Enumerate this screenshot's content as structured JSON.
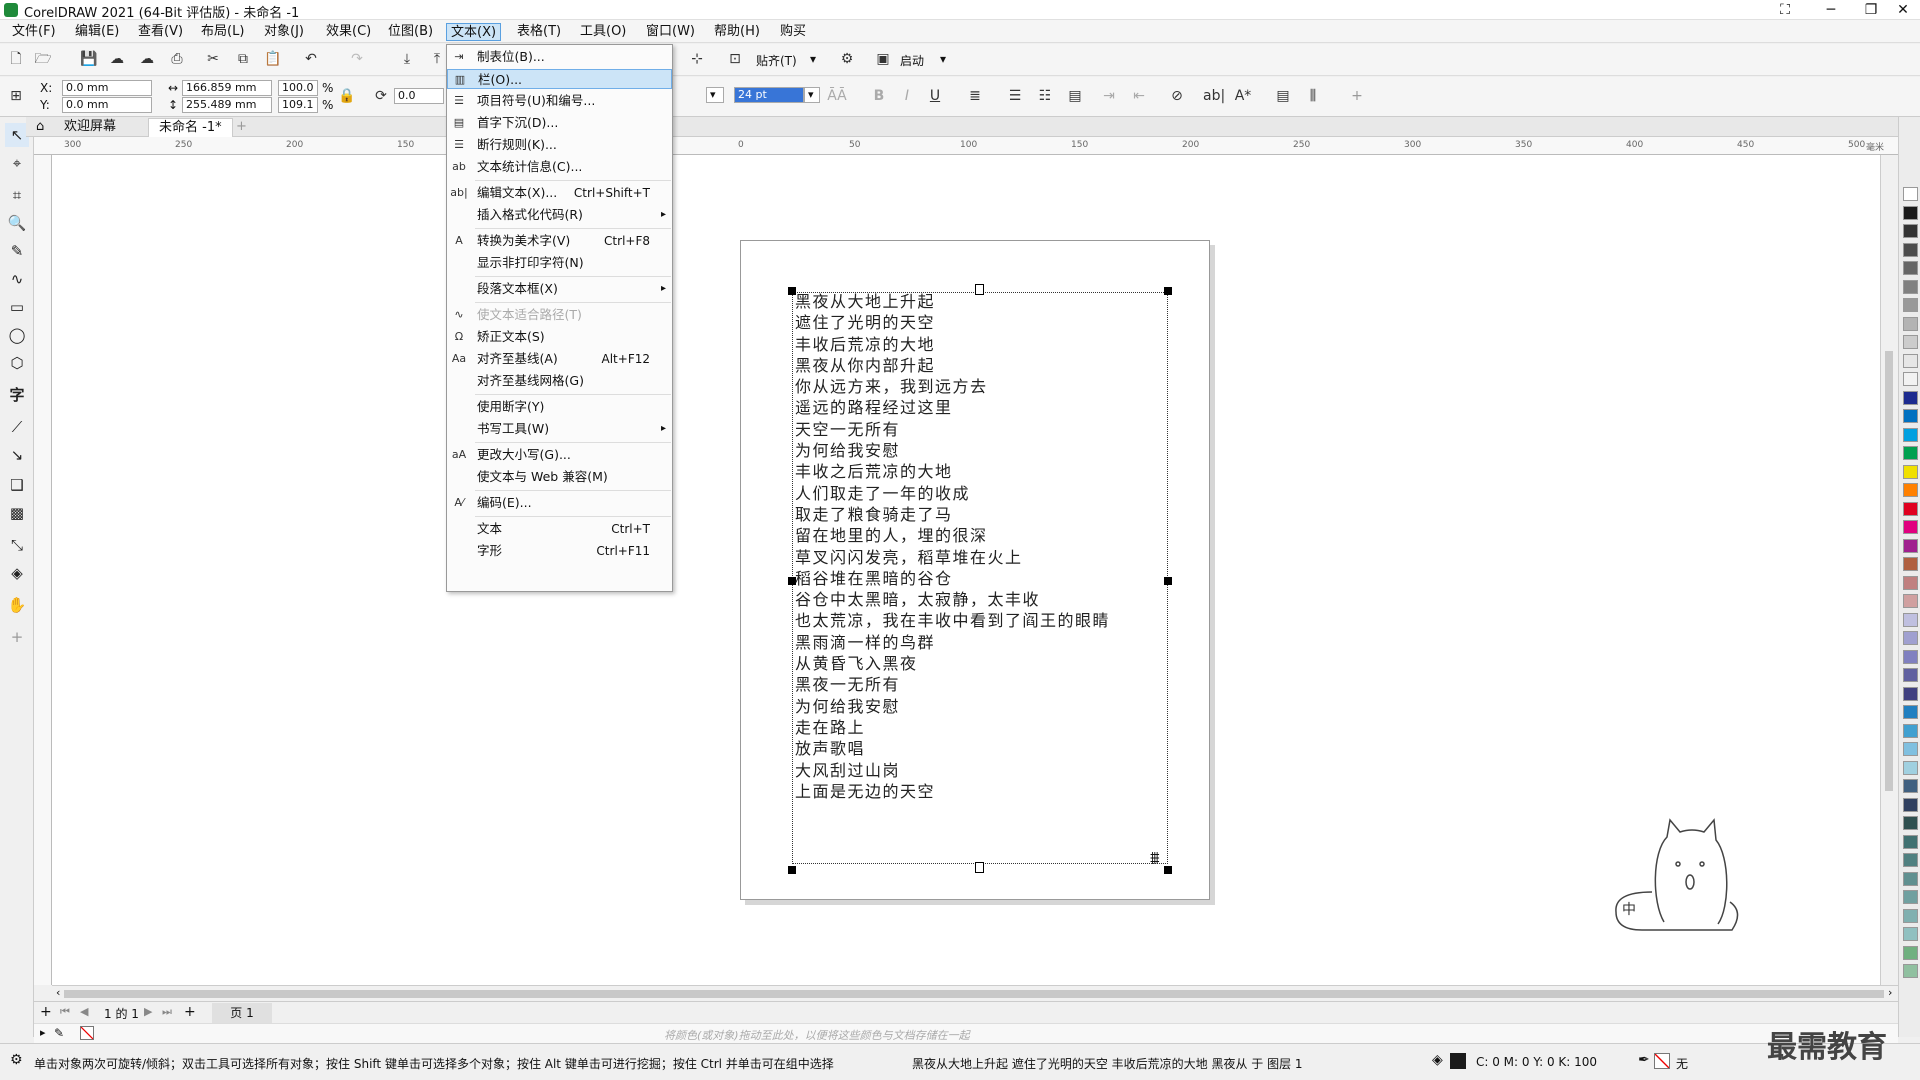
{
  "app": {
    "title": "CorelDRAW 2021 (64-Bit 评估版) - 未命名 -1"
  },
  "menu": [
    "文件(F)",
    "编辑(E)",
    "查看(V)",
    "布局(L)",
    "对象(J)",
    "效果(C)",
    "位图(B)",
    "文本(X)",
    "表格(T)",
    "工具(O)",
    "窗口(W)",
    "帮助(H)",
    "购买"
  ],
  "toolbar": {
    "snap_label": "贴齐(T)",
    "launch_label": "启动"
  },
  "props": {
    "x": "0.0 mm",
    "y": "0.0 mm",
    "w": "166.859 mm",
    "h": "255.489 mm",
    "sx": "100.0",
    "sy": "109.1",
    "pct": "%",
    "angle": "0.0",
    "font_size": "24 pt"
  },
  "tabs": {
    "welcome": "欢迎屏幕",
    "doc": "未命名 -1*"
  },
  "ruler": {
    "h": [
      "300",
      "250",
      "200",
      "150",
      "100",
      "50",
      "0",
      "50",
      "100",
      "150",
      "200",
      "250",
      "300",
      "350",
      "400",
      "450",
      "500"
    ],
    "unit": "毫米"
  },
  "dropdown": [
    {
      "label": "制表位(B)...",
      "icon": "tab-stops-icon"
    },
    {
      "label": "栏(O)...",
      "icon": "columns-icon",
      "hl": true
    },
    {
      "label": "项目符号(U)和编号...",
      "icon": "bullets-icon"
    },
    {
      "label": "首字下沉(D)...",
      "icon": "drop-cap-icon"
    },
    {
      "label": "断行规则(K)...",
      "icon": "line-break-icon"
    },
    {
      "label": "文本统计信息(C)...",
      "icon": "text-stats-icon"
    },
    {
      "sep": true
    },
    {
      "label": "编辑文本(X)...",
      "icon": "edit-text-icon",
      "shortcut": "Ctrl+Shift+T"
    },
    {
      "label": "插入格式化代码(R)",
      "arrow": true
    },
    {
      "sep": true
    },
    {
      "label": "转换为美术字(V)",
      "icon": "convert-artistic-icon",
      "shortcut": "Ctrl+F8"
    },
    {
      "label": "显示非打印字符(N)"
    },
    {
      "sep": true
    },
    {
      "label": "段落文本框(X)",
      "arrow": true
    },
    {
      "sep": true
    },
    {
      "label": "使文本适合路径(T)",
      "icon": "fit-path-icon",
      "dis": true
    },
    {
      "label": "矫正文本(S)",
      "icon": "straighten-text-icon"
    },
    {
      "label": "对齐至基线(A)",
      "icon": "align-baseline-icon",
      "shortcut": "Alt+F12"
    },
    {
      "label": "对齐至基线网格(G)"
    },
    {
      "sep": true
    },
    {
      "label": "使用断字(Y)"
    },
    {
      "label": "书写工具(W)",
      "arrow": true
    },
    {
      "sep": true
    },
    {
      "label": "更改大小写(G)...",
      "icon": "change-case-icon"
    },
    {
      "label": "使文本与 Web 兼容(M)"
    },
    {
      "sep": true
    },
    {
      "label": "编码(E)...",
      "icon": "encoding-icon"
    },
    {
      "sep": true
    },
    {
      "label": "文本",
      "shortcut": "Ctrl+T"
    },
    {
      "label": "字形",
      "shortcut": "Ctrl+F11"
    }
  ],
  "poem": [
    "黑夜从大地上升起",
    "遮住了光明的天空",
    "丰收后荒凉的大地",
    "黑夜从你内部升起",
    "你从远方来，我到远方去",
    "遥远的路程经过这里",
    "天空一无所有",
    "为何给我安慰",
    "丰收之后荒凉的大地",
    "人们取走了一年的收成",
    "取走了粮食骑走了马",
    "留在地里的人，埋的很深",
    "草叉闪闪发亮，稻草堆在火上",
    "稻谷堆在黑暗的谷仓",
    "谷仓中太黑暗，太寂静，太丰收",
    "也太荒凉，我在丰收中看到了阎王的眼睛",
    "黑雨滴一样的鸟群",
    "从黄昏飞入黑夜",
    "黑夜一无所有",
    "为何给我安慰",
    "走在路上",
    "放声歌唱",
    "大风刮过山岗",
    "上面是无边的天空"
  ],
  "pagenav": {
    "pageinfo": "1 的 1",
    "page_tab": "页 1"
  },
  "colorbar_hint": "将颜色(或对象)拖动至此处，以便将这些颜色与文档存储在一起",
  "status": {
    "hint": "单击对象两次可旋转/倾斜；双击工具可选择所有对象；按住 Shift 键单击可选择多个对象；按住 Alt 键单击可进行挖掘；按住 Ctrl 并单击可在组中选择",
    "sel": "黑夜从大地上升起 遮住了光明的天空 丰收后荒凉的大地 黑夜从 于 图层 1",
    "cmyk": "C: 0 M: 0 Y: 0 K: 100",
    "none": "无"
  },
  "cat_labels": {
    "zh": "中"
  },
  "watermark": "最需教育",
  "colors": {
    "accent": "#cce4f7",
    "swatches": [
      "#ffffff",
      "#1a1a1a",
      "#333333",
      "#4d4d4d",
      "#666666",
      "#808080",
      "#999999",
      "#b3b3b3",
      "#cccccc",
      "#e6e6e6",
      "#f2f2f2",
      "#1d2b8f",
      "#0070c0",
      "#00a0e0",
      "#00a050",
      "#f0e000",
      "#ff8000",
      "#e00020",
      "#e0007f",
      "#a0208f",
      "#b06040",
      "#c08080",
      "#d0a0a0",
      "#c0c0e0",
      "#a0a0d0",
      "#8080c0",
      "#6060a0",
      "#404080",
      "#207fc0",
      "#40a0d0",
      "#80c0e0",
      "#a0d0e0",
      "#406080",
      "#304060",
      "#305050",
      "#407070",
      "#508080",
      "#609090",
      "#70a0a0",
      "#80b0b0",
      "#90c0c0",
      "#70b080",
      "#90c0a0"
    ]
  }
}
